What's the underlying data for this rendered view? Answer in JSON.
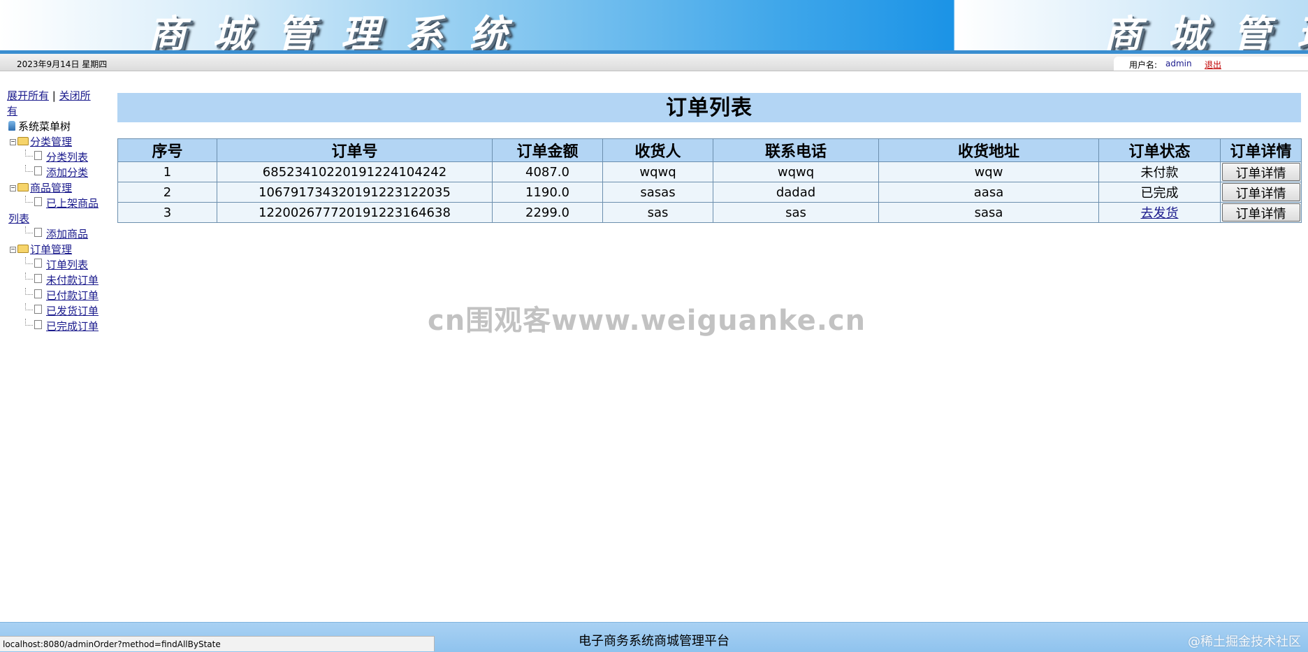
{
  "banner": {
    "title": "商城管理系统"
  },
  "infobar": {
    "date": "2023年9月14日 星期四",
    "user_label": "用户名:",
    "username": "admin",
    "logout": "退出"
  },
  "sidebar": {
    "expand_all": "展开所有",
    "separator": "|",
    "collapse_all": "关闭所有",
    "root": "系统菜单树",
    "groups": [
      {
        "label": "分类管理",
        "items": [
          "分类列表",
          "添加分类"
        ]
      },
      {
        "label": "商品管理",
        "items": [
          "已上架商品列表",
          "添加商品"
        ]
      },
      {
        "label": "订单管理",
        "items": [
          "订单列表",
          "未付款订单",
          "已付款订单",
          "已发货订单",
          "已完成订单"
        ]
      }
    ],
    "wrapped": {
      "product_list_a": "已上架商品",
      "product_list_b": "列表",
      "collapse_a": "关闭所",
      "collapse_b": "有"
    }
  },
  "main": {
    "title": "订单列表",
    "columns": [
      "序号",
      "订单号",
      "订单金额",
      "收货人",
      "联系电话",
      "收货地址",
      "订单状态",
      "订单详情"
    ],
    "rows": [
      {
        "index": "1",
        "order_no": "6852341022019122410424 2",
        "amount": "4087.0",
        "receiver": "wqwq",
        "phone": "wqwq",
        "address": "wqw",
        "status": "未付款",
        "status_link": false,
        "detail": "订单详情"
      },
      {
        "index": "2",
        "order_no": "10679173432019122312203 5",
        "amount": "1190.0",
        "receiver": "sasas",
        "phone": "dadad",
        "address": "aasa",
        "status": "已完成",
        "status_link": false,
        "detail": "订单详情"
      },
      {
        "index": "3",
        "order_no": "12200267772019122316463 8",
        "amount": "2299.0",
        "receiver": "sas",
        "phone": "sas",
        "address": "sasa",
        "status": "去发货",
        "status_link": true,
        "detail": "订单详情"
      }
    ]
  },
  "footer": {
    "text": "电子商务系统商城管理平台"
  },
  "status_bar": {
    "url": "localhost:8080/adminOrder?method=findAllByState"
  },
  "watermarks": {
    "center": "cn围观客www.weiguanke.cn",
    "corner": "@稀土掘金技术社区"
  },
  "colors": {
    "header_blue": "#b3d5f4",
    "banner_blue": "#1b93e6",
    "link": "#1a1a8c",
    "logout": "#c00000"
  }
}
